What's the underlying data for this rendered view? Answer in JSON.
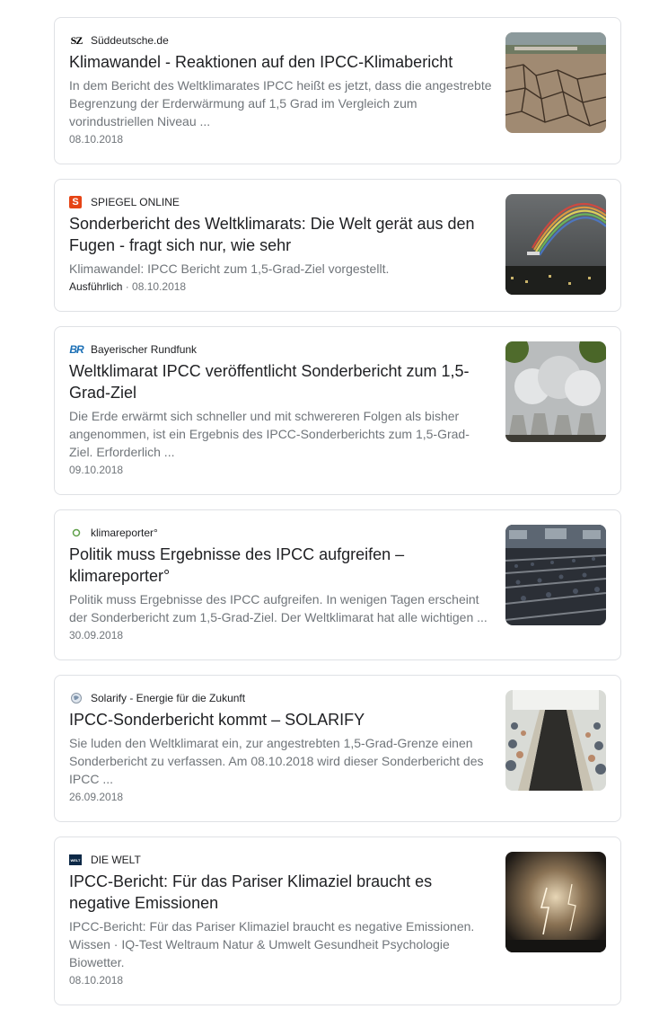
{
  "articles": [
    {
      "source": "Süddeutsche.de",
      "logo_text": "SZ",
      "headline": "Klimawandel - Reaktionen auf den IPCC-Klimabericht",
      "snippet": "In dem Bericht des Weltklimarates IPCC heißt es jetzt, dass die angestrebte Begrenzung der Erderwärmung auf 1,5 Grad im Vergleich zum vorindustriellen Niveau ...",
      "extra": "",
      "date": "08.10.2018",
      "thumbnail_icon": "cracked-earth-image"
    },
    {
      "source": "SPIEGEL ONLINE",
      "logo_text": "S",
      "headline": "Sonderbericht des Weltklimarats: Die Welt gerät aus den Fugen - fragt sich nur, wie sehr",
      "snippet": "Klimawandel: IPCC Bericht zum 1,5-Grad-Ziel vorgestellt.",
      "extra": "Ausführlich",
      "date": "08.10.2018",
      "thumbnail_icon": "rainbow-image"
    },
    {
      "source": "Bayerischer Rundfunk",
      "logo_text": "BR",
      "headline": "Weltklimarat IPCC veröffentlicht Sonderbericht zum 1,5-Grad-Ziel",
      "snippet": "Die Erde erwärmt sich schneller und mit schwereren Folgen als bisher angenommen, ist ein Ergebnis des IPCC-Sonderberichts zum 1,5-Grad-Ziel. Erforderlich ...",
      "extra": "",
      "date": "09.10.2018",
      "thumbnail_icon": "cooling-towers-image"
    },
    {
      "source": "klimareporter°",
      "logo_text": "°",
      "headline": "Politik muss Ergebnisse des IPCC aufgreifen – klimareporter°",
      "snippet": "Politik muss Ergebnisse des IPCC aufgreifen. In wenigen Tagen erscheint der Sonderbericht zum 1,5-Grad-Ziel. Der Weltklimarat hat alle wichtigen ...",
      "extra": "",
      "date": "30.09.2018",
      "thumbnail_icon": "conference-hall-image"
    },
    {
      "source": "Solarify - Energie für die Zukunft",
      "logo_text": "",
      "headline": "IPCC-Sonderbericht kommt – SOLARIFY",
      "snippet": "Sie luden den Weltklimarat ein, zur angestrebten 1,5-Grad-Grenze einen Sonderbericht zu verfassen. Am 08.10.2018 wird dieser Sonderbericht des IPCC ...",
      "extra": "",
      "date": "26.09.2018",
      "thumbnail_icon": "meeting-table-image"
    },
    {
      "source": "DIE WELT",
      "logo_text": "WELT",
      "headline": "IPCC-Bericht: Für das Pariser Klimaziel braucht es negative Emissionen",
      "snippet": "IPCC-Bericht: Für das Pariser Klimaziel braucht es negative Emissionen. Wissen · IQ-Test Weltraum Natur & Umwelt Gesundheit Psychologie Biowetter.",
      "extra": "",
      "date": "08.10.2018",
      "thumbnail_icon": "lightning-storm-image"
    }
  ]
}
